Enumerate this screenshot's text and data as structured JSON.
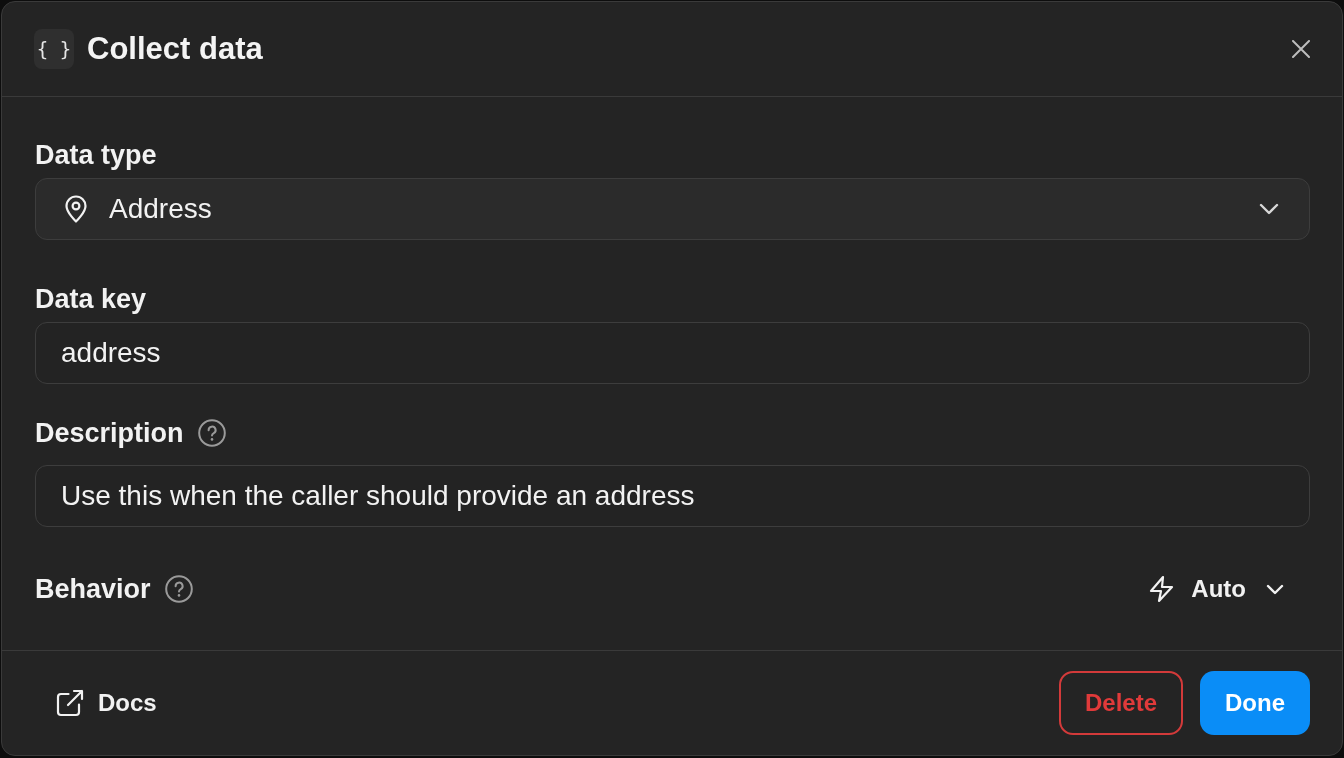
{
  "dialog": {
    "title_icon": "{ }",
    "title": "Collect data"
  },
  "fields": [
    {
      "kind": "select",
      "label": "Data type",
      "value": "Address",
      "help": false
    },
    {
      "kind": "text",
      "label": "Data key",
      "value": "address",
      "help": false
    },
    {
      "kind": "text",
      "label": "Description",
      "value": "Use this when the caller should provide an address",
      "help": true
    },
    {
      "kind": "menu",
      "label": "Behavior",
      "value": "Auto",
      "help": true
    }
  ],
  "footer": {
    "link": "Docs",
    "buttons": [
      {
        "label": "Delete",
        "kind": "danger"
      },
      {
        "label": "Done",
        "kind": "primary"
      }
    ]
  }
}
